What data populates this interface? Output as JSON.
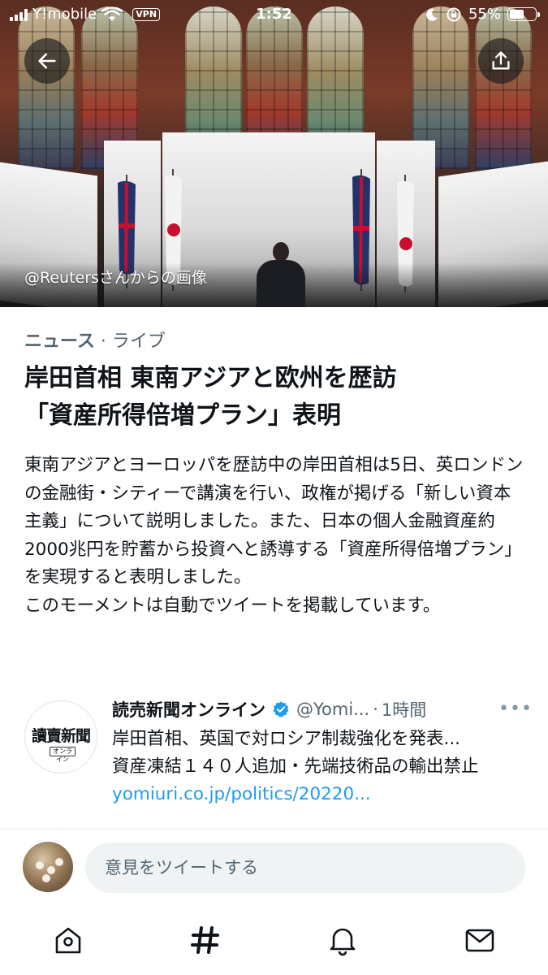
{
  "status_bar": {
    "carrier": "Y!mobile",
    "vpn": "VPN",
    "time": "1:52",
    "battery": "55%",
    "battery_level": 0.55
  },
  "hero": {
    "caption": "@Reutersさんからの画像",
    "back_icon": "arrow-left-icon",
    "share_icon": "share-icon"
  },
  "article": {
    "category": "ニュース",
    "separator": " · ",
    "status": "ライブ",
    "headline_line1": "岸田首相 東南アジアと欧州を歴訪",
    "headline_line2": "「資産所得倍増プラン」表明",
    "description": "東南アジアとヨーロッパを歴訪中の岸田首相は5日、英ロンドンの金融街・シティーで講演を行い、政権が掲げる「新しい資本主義」について説明しました。また、日本の個人金融資産約2000兆円を貯蓄から投資へと誘導する「資産所得倍増プラン」を実現すると表明しました。",
    "auto_note": "このモーメントは自動でツイートを掲載しています。"
  },
  "tweet": {
    "avatar_logo": "讀賣新聞",
    "avatar_sub": "オンライン",
    "name": "読売新聞オンライン",
    "handle": "@Yomi...",
    "separator": "·",
    "time": "1時間",
    "more": "•••",
    "line1": "岸田首相、英国で対ロシア制裁強化を発表...",
    "line2": "資産凍結１４０人追加・先端技術品の輸出禁止",
    "link": "yomiuri.co.jp/politics/20220..."
  },
  "reply": {
    "placeholder": "意見をツイートする"
  },
  "tabbar": {
    "icons": [
      "home-icon",
      "explore-icon",
      "notifications-icon",
      "messages-icon"
    ]
  },
  "colors": {
    "accent": "#1d9bf0",
    "secondary_text": "#536471",
    "primary_text": "#0f1419"
  }
}
